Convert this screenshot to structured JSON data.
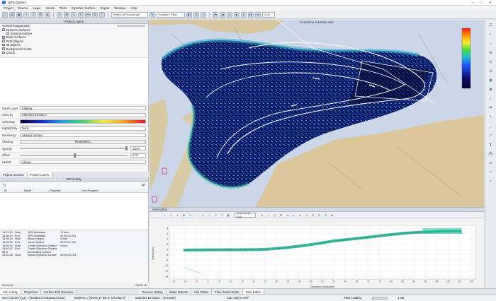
{
  "window": {
    "title": "QPS Qimera",
    "controls": [
      "–",
      "□",
      "✕"
    ]
  },
  "menu": [
    "Project",
    "Source",
    "Layer",
    "Scene",
    "Tools",
    "Dynamic Surface",
    "Export",
    "Window",
    "Help"
  ],
  "toolbar": {
    "reject_dropdown": "Reject All Soundings",
    "surface_dropdown": "Surface / Filter",
    "zoom_value": "2.00"
  },
  "layers_panel": {
    "header": "Project Layers",
    "vertical_exaggeration_label": "Vertical Exaggeration",
    "tree": [
      {
        "label": "Dynamic Surfaces",
        "checked": true,
        "indent": 0
      },
      {
        "label": "DynamicSurface",
        "checked": true,
        "indent": 1
      },
      {
        "label": "Static Surfaces",
        "checked": true,
        "indent": 0
      },
      {
        "label": "PFM Objects",
        "checked": true,
        "indent": 0
      },
      {
        "label": "3d Objects",
        "checked": true,
        "indent": 0
      },
      {
        "label": "Background Charts",
        "checked": true,
        "indent": 0
      },
      {
        "label": "Charts",
        "checked": true,
        "indent": 0
      }
    ],
    "props": {
      "depth_layer_label": "Depth Layer",
      "depth_layer_value": "Shallow",
      "color_by_label": "Color by",
      "color_by_value": "Standard Deviation",
      "colormap_label": "Colormap",
      "highlight_label": "Highlight by",
      "highlight_value": "None",
      "rendering_label": "Rendering",
      "rendering_value": "Shaded Surface",
      "shading_label": "Shading",
      "shading_value": "Parameters...",
      "opacity_label": "Opacity",
      "opacity_value": "100%",
      "offset_label": "Offset",
      "offset_value": "0.00",
      "update_label": "Update",
      "update_value": "Always"
    }
  },
  "left_tabs": [
    "Project Sources",
    "Project Layers"
  ],
  "jobs_panel": {
    "header": "Job Activity",
    "columns": [
      "ID",
      "Name",
      "Progress",
      "Core Progress"
    ],
    "log": [
      [
        "15:07:29",
        "Start",
        "QPD Metadata",
        "12 time"
      ],
      [
        "15:08:14",
        "End",
        "QPD Metadata",
        "00:00:14.004"
      ],
      [
        "15:08:14",
        "Start",
        "Import Object",
        "0 time"
      ],
      [
        "15:08:15",
        "End",
        "Import Object",
        "00:00:01.061"
      ],
      [
        "15:08:14",
        "Start",
        "Create Dynamic Surface",
        "0 time"
      ],
      [
        "15:10:47",
        "End",
        "Create Dynamic Surface",
        ""
      ],
      [
        "MPd",
        "",
        "Illuminating Surface",
        ""
      ],
      [
        "15:10:48",
        "Start",
        "Shade Dynamic Surface",
        "00:00:00.104"
      ]
    ],
    "elapsed_left": "00:00:00",
    "elapsed_right": "00:00:16"
  },
  "bottom_tabs": [
    "Job Activity",
    "Properties",
    "Surface Edit Overview",
    "Process History",
    "Water Column",
    "File Tables",
    "Time Series Editor",
    "Slice Editor"
  ],
  "status": {
    "geo_coords": "Geo Coords (x,y,z) = (294851.2 4463155.3 5.53)",
    "dist": "Dist/Hint = (57101.17 EE N, 6707.53 N)",
    "std_dev": "Standard Deviation = (0.03314)",
    "auto_import": "Auto Import: OFF",
    "files_loading": "Files Loading:",
    "memory": "1 GB"
  },
  "map": {
    "title": "Overdrone exsortion data",
    "colorbar_colors": [
      "#ff1a1a",
      "#ff9900",
      "#ffee33",
      "#44dd44",
      "#22bbcc",
      "#1a55ff",
      "#101070",
      "#000033"
    ]
  },
  "slice_editor": {
    "header": "Slice Editor",
    "select_dropdown": "Select and Edit",
    "y_label": "Depth (m)",
    "x_label": "Distance Along (m)",
    "y_ticks": [
      "4",
      "2",
      "0",
      "-2",
      "-4",
      "-6",
      "-8",
      "-10",
      "-12",
      "-14"
    ],
    "x_ticks": [
      "-15",
      "-10",
      "-5",
      "0",
      "5",
      "10",
      "15",
      "20",
      "25",
      "30",
      "35",
      "40",
      "45",
      "50",
      "55",
      "60",
      "65",
      "70",
      "75",
      "80",
      "85",
      "90",
      "95",
      "100",
      "105",
      "110",
      "115"
    ]
  }
}
